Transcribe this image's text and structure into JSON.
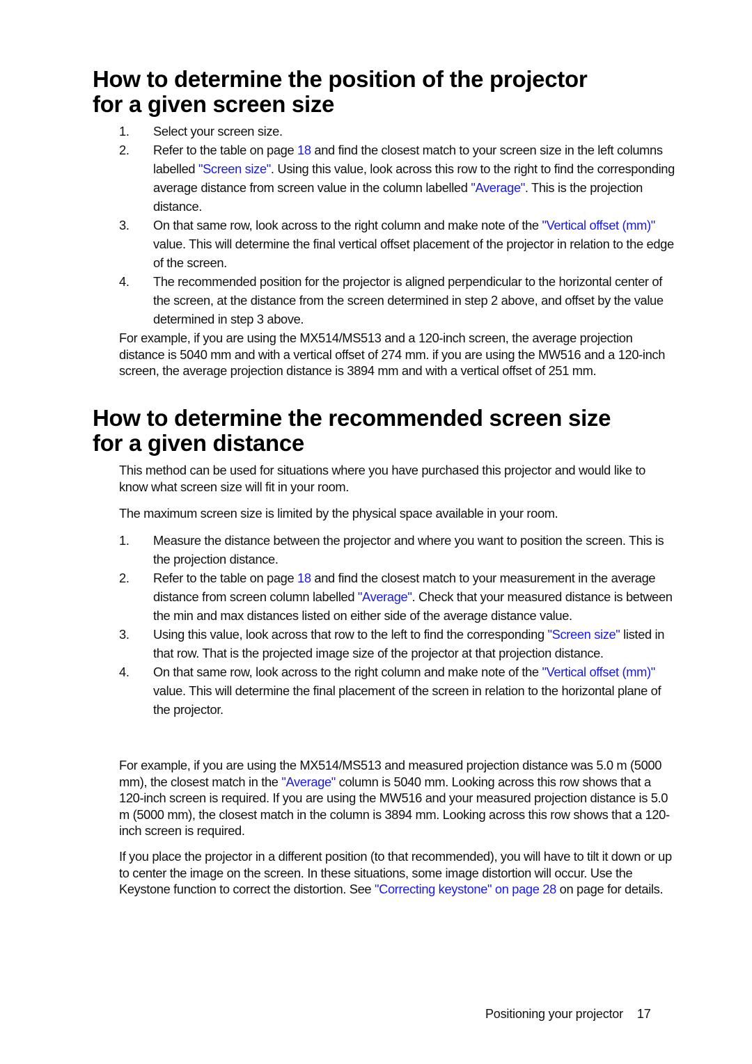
{
  "section1": {
    "heading_line1": "How to determine the position of the projector",
    "heading_line2": "for a given screen size",
    "steps": [
      {
        "num": "1.",
        "parts": [
          {
            "t": "Select your screen size."
          }
        ]
      },
      {
        "num": "2.",
        "parts": [
          {
            "t": "Refer to the table on page "
          },
          {
            "t": "18",
            "link": true
          },
          {
            "t": " and find the closest match to your screen size in the left columns labelled "
          },
          {
            "t": "\"Screen size\"",
            "link": true
          },
          {
            "t": ". Using this value, look across this row to the right to find the corresponding average distance from screen value in the column labelled "
          },
          {
            "t": "\"Average\"",
            "link": true
          },
          {
            "t": ". This is the projection distance."
          }
        ]
      },
      {
        "num": "3.",
        "parts": [
          {
            "t": "On that same row, look across to the right column and make note of the "
          },
          {
            "t": "\"Vertical offset (mm)\"",
            "link": true
          },
          {
            "t": " value. This will determine the final vertical offset placement of the projector in relation to the edge of the screen."
          }
        ]
      },
      {
        "num": "4.",
        "parts": [
          {
            "t": "The recommended position for the projector is aligned perpendicular to the horizontal center of the screen, at the distance from the screen determined in step 2 above, and offset by the value determined in step 3 above."
          }
        ]
      }
    ],
    "example": "For example, if you are using the MX514/MS513 and a 120-inch screen, the average projection distance is 5040 mm and with a vertical offset of 274 mm. if you are using the MW516 and a 120-inch screen, the average projection distance is 3894 mm and with a vertical offset of 251 mm."
  },
  "section2": {
    "heading_line1": "How to determine the recommended screen size",
    "heading_line2": "for a given distance",
    "intro": "This method can be used for situations where you have purchased this projector and would like to know what screen size will fit in your room.",
    "limit": "The maximum screen size is limited by the physical space available in your room.",
    "steps": [
      {
        "num": "1.",
        "parts": [
          {
            "t": "Measure the distance between the projector and where you want to position the screen. This is the projection distance."
          }
        ]
      },
      {
        "num": "2.",
        "parts": [
          {
            "t": "Refer to the table on page "
          },
          {
            "t": "18",
            "link": true
          },
          {
            "t": " and find the closest match to your measurement in the average distance from screen column labelled "
          },
          {
            "t": "\"Average\"",
            "link": true
          },
          {
            "t": ". Check that your measured distance is between the min and max distances listed on either side of the average distance value."
          }
        ]
      },
      {
        "num": "3.",
        "parts": [
          {
            "t": "Using this value, look across that row to the left to find the corresponding "
          },
          {
            "t": "\"Screen size\"",
            "link": true
          },
          {
            "t": " listed in that row. That is the projected image size of the projector at that projection distance."
          }
        ]
      },
      {
        "num": "4.",
        "parts": [
          {
            "t": "On that same row, look across to the right column and make note of the "
          },
          {
            "t": "\"Vertical offset (mm)\"",
            "link": true
          },
          {
            "t": " value. This will determine the final placement of the screen in relation to the horizontal plane of the projector."
          }
        ]
      }
    ],
    "example_parts": [
      {
        "t": "For example, if you are using the MX514/MS513 and measured projection distance was 5.0 m (5000 mm), the closest match in the "
      },
      {
        "t": "\"Average\"",
        "link": true
      },
      {
        "t": " column is 5040 mm. Looking across this row shows that a 120-inch screen is required. If you are using the MW516 and your measured projection distance is 5.0 m (5000 mm), the closest match in the column is 3894 mm. Looking across this row shows that a 120-inch screen is required."
      }
    ],
    "note_parts": [
      {
        "t": "If you place the projector in a different position (to that recommended), you will have to tilt it down or up to center the image on the screen. In these situations, some image distortion will occur. Use the Keystone function to correct the distortion. See "
      },
      {
        "t": "\"Correcting keystone\" on page 28",
        "link": true
      },
      {
        "t": " on page for details."
      }
    ]
  },
  "footer": {
    "section_title": "Positioning your projector",
    "page_number": "17"
  },
  "colors": {
    "link": "#1a1ae6",
    "text": "#111111"
  }
}
